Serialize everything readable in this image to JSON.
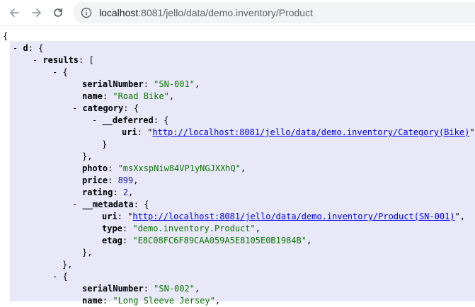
{
  "browser": {
    "url_host": "localhost",
    "url_path": ":8081/jello/data/demo.inventory/Product"
  },
  "json": {
    "open_brace": "{",
    "d_key": "d",
    "results_key": "results",
    "item1": {
      "serialNumber": "\"SN-001\"",
      "name": "\"Road Bike\"",
      "category_deferred_uri": "http://localhost:8081/jello/data/demo.inventory/Category(Bike)",
      "photo": "\"msXxspNiw84VP1yNGJXXhQ\"",
      "price": "899",
      "rating": "2",
      "metadata_uri": "http://localhost:8081/jello/data/demo.inventory/Product(SN-001)",
      "metadata_type": "\"demo.inventory.Product\"",
      "metadata_etag": "\"E8C08FC6F89CAA059A5E8105E0B1984B\""
    },
    "item2": {
      "serialNumber": "\"SN-002\"",
      "name": "\"Long Sleeve Jersey\""
    },
    "keys": {
      "serialNumber": "serialNumber",
      "name": "name",
      "category": "category",
      "deferred": "__deferred",
      "uri": "uri",
      "photo": "photo",
      "price": "price",
      "rating": "rating",
      "metadata": "__metadata",
      "type": "type",
      "etag": "etag"
    }
  }
}
